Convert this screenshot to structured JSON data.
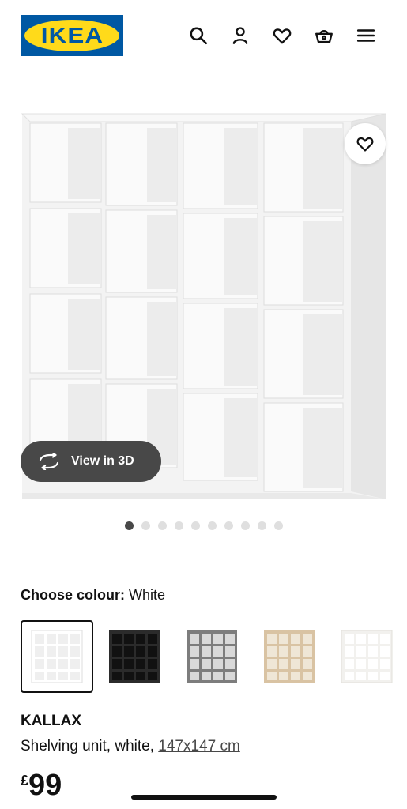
{
  "header": {
    "logo_text": "IKEA",
    "brand_colors": {
      "blue": "#0058a3",
      "yellow": "#ffda1a"
    },
    "icons": [
      "search-icon",
      "user-icon",
      "heart-icon",
      "basket-icon",
      "menu-icon"
    ]
  },
  "gallery": {
    "view_3d_label": "View in 3D",
    "slide_count": 10,
    "active_slide": 1
  },
  "colour": {
    "label": "Choose colour:",
    "selected": "White",
    "options": [
      {
        "name": "White",
        "color": "#ffffff",
        "selected": true
      },
      {
        "name": "Black-brown",
        "color": "#2b2b2b",
        "selected": false
      },
      {
        "name": "Grey",
        "color": "#7d7d7d",
        "selected": false
      },
      {
        "name": "Oak effect",
        "color": "#d9c3a3",
        "selected": false
      },
      {
        "name": "White oak effect",
        "color": "#f2f1ee",
        "selected": false
      }
    ]
  },
  "product": {
    "name": "KALLAX",
    "description": "Shelving unit, white,",
    "dimensions": "147x147 cm",
    "currency": "£",
    "price": "99"
  }
}
